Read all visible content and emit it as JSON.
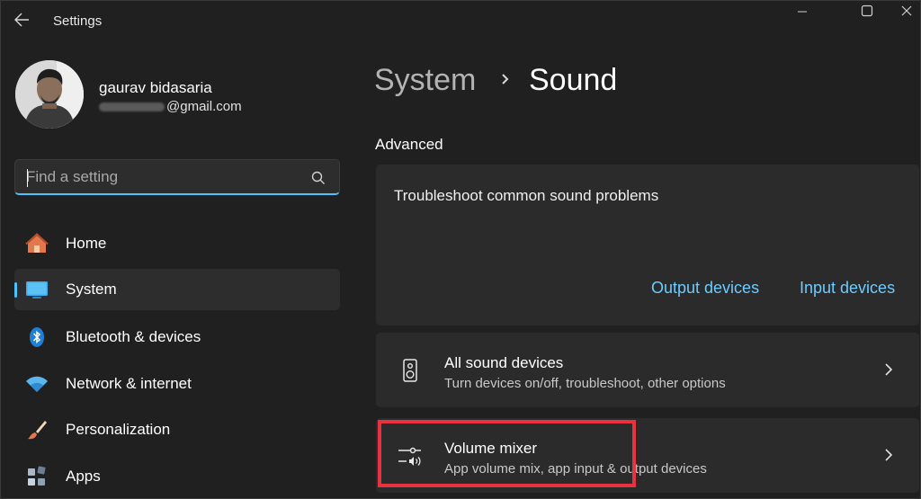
{
  "window": {
    "title": "Settings",
    "controls": [
      "minimize",
      "maximize",
      "close"
    ]
  },
  "profile": {
    "name": "gaurav bidasaria",
    "email_suffix": "@gmail.com"
  },
  "search": {
    "placeholder": "Find a setting"
  },
  "nav": {
    "items": [
      {
        "label": "Home",
        "icon": "home-icon"
      },
      {
        "label": "System",
        "icon": "monitor-icon",
        "active": true
      },
      {
        "label": "Bluetooth & devices",
        "icon": "bluetooth-icon"
      },
      {
        "label": "Network & internet",
        "icon": "wifi-icon"
      },
      {
        "label": "Personalization",
        "icon": "brush-icon"
      },
      {
        "label": "Apps",
        "icon": "apps-icon"
      }
    ]
  },
  "breadcrumb": {
    "parent": "System",
    "current": "Sound"
  },
  "main": {
    "section_title": "Advanced",
    "troubleshoot": {
      "label": "Troubleshoot common sound problems",
      "link_output": "Output devices",
      "link_input": "Input devices"
    },
    "rows": [
      {
        "title": "All sound devices",
        "subtitle": "Turn devices on/off, troubleshoot, other options",
        "icon": "speaker-icon"
      },
      {
        "title": "Volume mixer",
        "subtitle": "App volume mix, app input & output devices",
        "icon": "volume-mixer-icon"
      }
    ]
  },
  "colors": {
    "background": "#202020",
    "card": "#2b2b2b",
    "accent": "#4cc2ff",
    "link": "#6ccbff",
    "highlight": "#e8333f"
  }
}
